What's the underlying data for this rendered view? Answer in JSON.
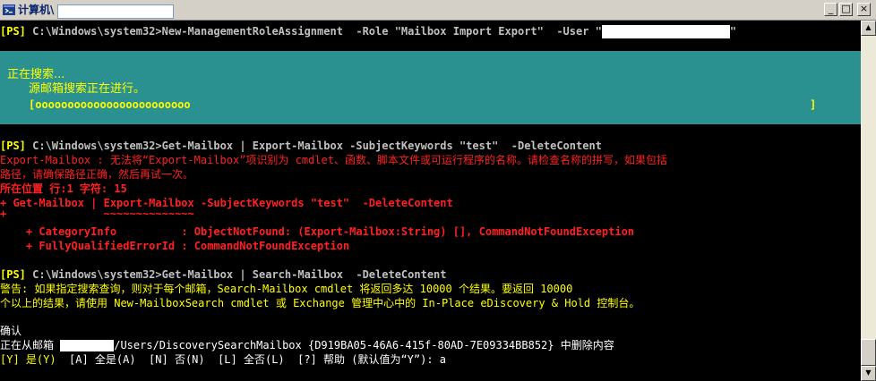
{
  "window": {
    "title": "计算机\\"
  },
  "console": {
    "cmd1": {
      "prompt": "[PS]",
      "text": " C:\\Windows\\system32>New-ManagementRoleAssignment  -Role \"Mailbox Import Export\"  -User \"",
      "tail": "\""
    },
    "progress": {
      "title": "正在搜索...",
      "status": "源邮箱搜索正在进行。",
      "bar": "[oooooooooooooooooooooooo",
      "bar_end": "]"
    },
    "cmd2": {
      "prompt": "[PS]",
      "text": " C:\\Windows\\system32>Get-Mailbox | Export-Mailbox -SubjectKeywords \"test\"  -DeleteContent"
    },
    "error": {
      "line1": "Export-Mailbox : 无法将“Export-Mailbox”项识别为 cmdlet、函数、脚本文件或可运行程序的名称。请检查名称的拼写，如果包括",
      "line2": "路径，请确保路径正确，然后再试一次。",
      "line3": "所在位置 行:1 字符: 15",
      "line4": "+ Get-Mailbox | Export-Mailbox -SubjectKeywords \"test\"  -DeleteContent",
      "line5": "+               ~~~~~~~~~~~~~~",
      "line6": "    + CategoryInfo          : ObjectNotFound: (Export-Mailbox:String) [], CommandNotFoundException",
      "line7": "    + FullyQualifiedErrorId : CommandNotFoundException"
    },
    "cmd3": {
      "prompt": "[PS]",
      "text": " C:\\Windows\\system32>Get-Mailbox | Search-Mailbox  -DeleteContent"
    },
    "warning": {
      "line1": "警告: 如果指定搜索查询，则对于每个邮箱，Search-Mailbox cmdlet 将返回多达 10000 个结果。要返回 10000",
      "line2": "个以上的结果，请使用 New-MailboxSearch cmdlet 或 Exchange 管理中心中的 In-Place eDiscovery & Hold 控制台。"
    },
    "confirm": {
      "title": "确认",
      "deleting_prefix": "正在从邮箱 ",
      "deleting_suffix": "/Users/DiscoverySearchMailbox {D919BA05-46A6-415f-80AD-7E09334BB852} 中删除内容",
      "choice_yes": "[Y] 是(Y)",
      "choices_rest": "  [A] 全是(A)  [N] 否(N)  [L] 全否(L)  [?] 帮助 (默认值为“Y”): a"
    }
  }
}
